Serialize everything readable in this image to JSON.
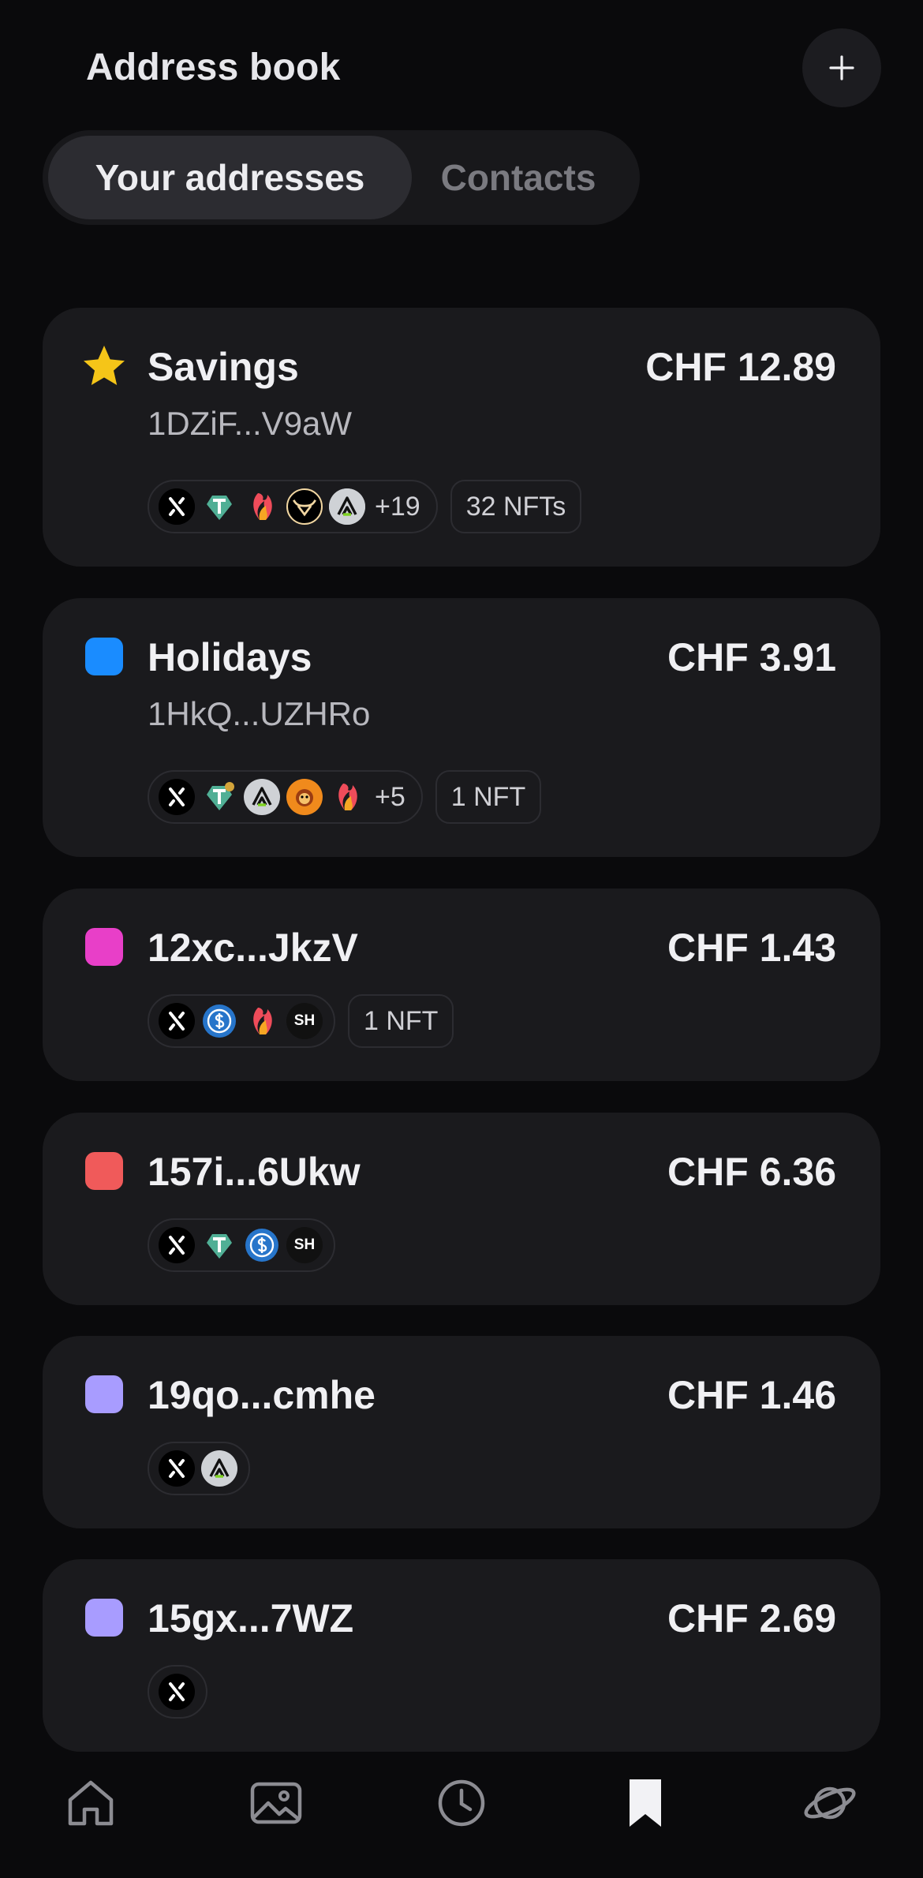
{
  "header": {
    "title": "Address book"
  },
  "tabs": [
    {
      "label": "Your addresses",
      "active": true
    },
    {
      "label": "Contacts",
      "active": false
    }
  ],
  "colors": {
    "background": "#0a0a0c",
    "card": "#1a1a1d",
    "star": "#f5c518",
    "blue": "#1a8cff",
    "pink": "#e83fc8",
    "red": "#f05a5a",
    "lavender": "#a89cff"
  },
  "addresses": [
    {
      "name": "Savings",
      "address": "1DZiF...V9aW",
      "balance": "CHF 12.89",
      "marker": "star-icon",
      "tokens": [
        "x-token-icon",
        "tether-gold-icon",
        "phoenix-token-icon",
        "bull-token-icon",
        "arrow-token-icon"
      ],
      "more": "+19",
      "nfts": "32 NFTs"
    },
    {
      "name": "Holidays",
      "address": "1HkQ...UZHRo",
      "balance": "CHF 3.91",
      "marker": "blue",
      "tokens": [
        "x-token-icon",
        "tether-gold-icon",
        "arrow-token-icon",
        "lion-token-icon",
        "phoenix-token-icon"
      ],
      "more": "+5",
      "nfts": "1 NFT"
    },
    {
      "name": "12xc...JkzV",
      "balance": "CHF 1.43",
      "marker": "pink",
      "tokens": [
        "x-token-icon",
        "usdc-token-icon",
        "phoenix-token-icon"
      ],
      "text_token": "SH",
      "nfts": "1 NFT"
    },
    {
      "name": "157i...6Ukw",
      "balance": "CHF 6.36",
      "marker": "red",
      "tokens": [
        "x-token-icon",
        "tether-gold-icon",
        "usdc-token-icon"
      ],
      "text_token": "SH"
    },
    {
      "name": "19qo...cmhe",
      "balance": "CHF 1.46",
      "marker": "lavender",
      "tokens": [
        "x-token-icon",
        "arrow-token-icon"
      ]
    },
    {
      "name": "15gx...7WZ",
      "balance": "CHF 2.69",
      "marker": "lavender",
      "tokens": [
        "x-token-icon"
      ]
    }
  ],
  "nav": [
    {
      "icon": "home-icon",
      "active": false
    },
    {
      "icon": "gallery-icon",
      "active": false
    },
    {
      "icon": "clock-icon",
      "active": false
    },
    {
      "icon": "bookmark-icon",
      "active": true
    },
    {
      "icon": "planet-icon",
      "active": false
    }
  ]
}
